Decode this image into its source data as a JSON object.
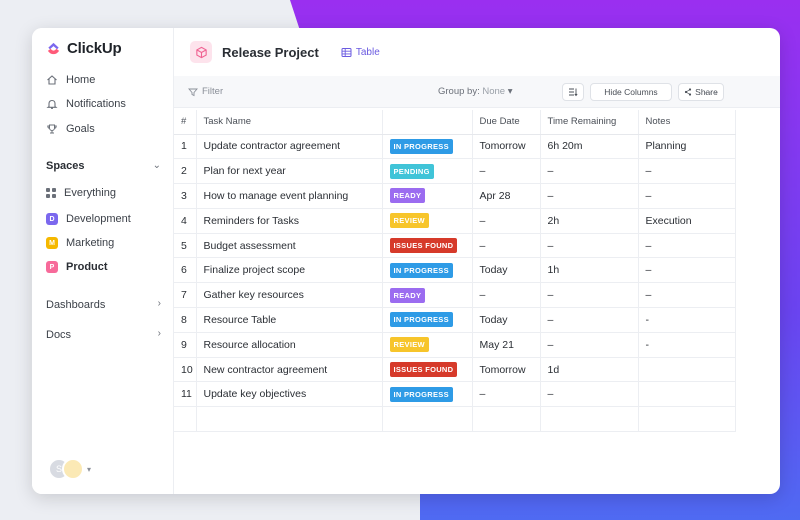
{
  "app": {
    "name": "ClickUp"
  },
  "sidebar": {
    "nav": [
      {
        "label": "Home",
        "icon": "home-icon"
      },
      {
        "label": "Notifications",
        "icon": "bell-icon"
      },
      {
        "label": "Goals",
        "icon": "trophy-icon"
      }
    ],
    "spaces_title": "Spaces",
    "spaces": [
      {
        "label": "Everything",
        "badge": "",
        "color": ""
      },
      {
        "label": "Development",
        "badge": "D",
        "color": "#7b68ee"
      },
      {
        "label": "Marketing",
        "badge": "M",
        "color": "#f5b800"
      },
      {
        "label": "Product",
        "badge": "P",
        "color": "#f76a9a"
      }
    ],
    "dashboards": "Dashboards",
    "docs": "Docs",
    "avatar_initial": "S"
  },
  "header": {
    "project_title": "Release Project",
    "view_label": "Table"
  },
  "toolbar": {
    "filter": "Filter",
    "group_by_label": "Group by:",
    "group_by_value": "None",
    "hide_columns": "Hide Columns",
    "share": "Share"
  },
  "table": {
    "columns": [
      "#",
      "Task Name",
      "",
      "Due Date",
      "Time Remaining",
      "Notes"
    ],
    "rows": [
      {
        "n": "1",
        "task": "Update contractor agreement",
        "status": "IN PROGRESS",
        "status_color": "#2e9be6",
        "due": "Tomorrow",
        "due_red": false,
        "time": "6h 20m",
        "notes": "Planning"
      },
      {
        "n": "2",
        "task": "Plan for next year",
        "status": "PENDING",
        "status_color": "#40c4d8",
        "due": "–",
        "due_red": false,
        "time": "–",
        "notes": "–"
      },
      {
        "n": "3",
        "task": "How to manage event planning",
        "status": "READY",
        "status_color": "#9b6cf0",
        "due": "Apr 28",
        "due_red": true,
        "time": "–",
        "notes": "–"
      },
      {
        "n": "4",
        "task": "Reminders for Tasks",
        "status": "REVIEW",
        "status_color": "#f7c52b",
        "due": "–",
        "due_red": false,
        "time": "2h",
        "notes": "Execution"
      },
      {
        "n": "5",
        "task": "Budget assessment",
        "status": "ISSUES FOUND",
        "status_color": "#d63a2a",
        "due": "–",
        "due_red": false,
        "time": "–",
        "notes": "–"
      },
      {
        "n": "6",
        "task": "Finalize project  scope",
        "status": "IN PROGRESS",
        "status_color": "#2e9be6",
        "due": "Today",
        "due_red": true,
        "time": "1h",
        "notes": "–"
      },
      {
        "n": "7",
        "task": "Gather key resources",
        "status": "READY",
        "status_color": "#9b6cf0",
        "due": "–",
        "due_red": false,
        "time": "–",
        "notes": "–"
      },
      {
        "n": "8",
        "task": "Resource Table",
        "status": "IN PROGRESS",
        "status_color": "#2e9be6",
        "due": "Today",
        "due_red": true,
        "time": "–",
        "notes": "-"
      },
      {
        "n": "9",
        "task": "Resource allocation",
        "status": "REVIEW",
        "status_color": "#f7c52b",
        "due": "May 21",
        "due_red": false,
        "time": "–",
        "notes": "-"
      },
      {
        "n": "10",
        "task": "New contractor agreement",
        "status": "ISSUES FOUND",
        "status_color": "#d63a2a",
        "due": "Tomorrow",
        "due_red": false,
        "time": "1d",
        "notes": ""
      },
      {
        "n": "11",
        "task": "Update key objectives",
        "status": "IN PROGRESS",
        "status_color": "#2e9be6",
        "due": "–",
        "due_red": false,
        "time": "–",
        "notes": ""
      }
    ]
  }
}
